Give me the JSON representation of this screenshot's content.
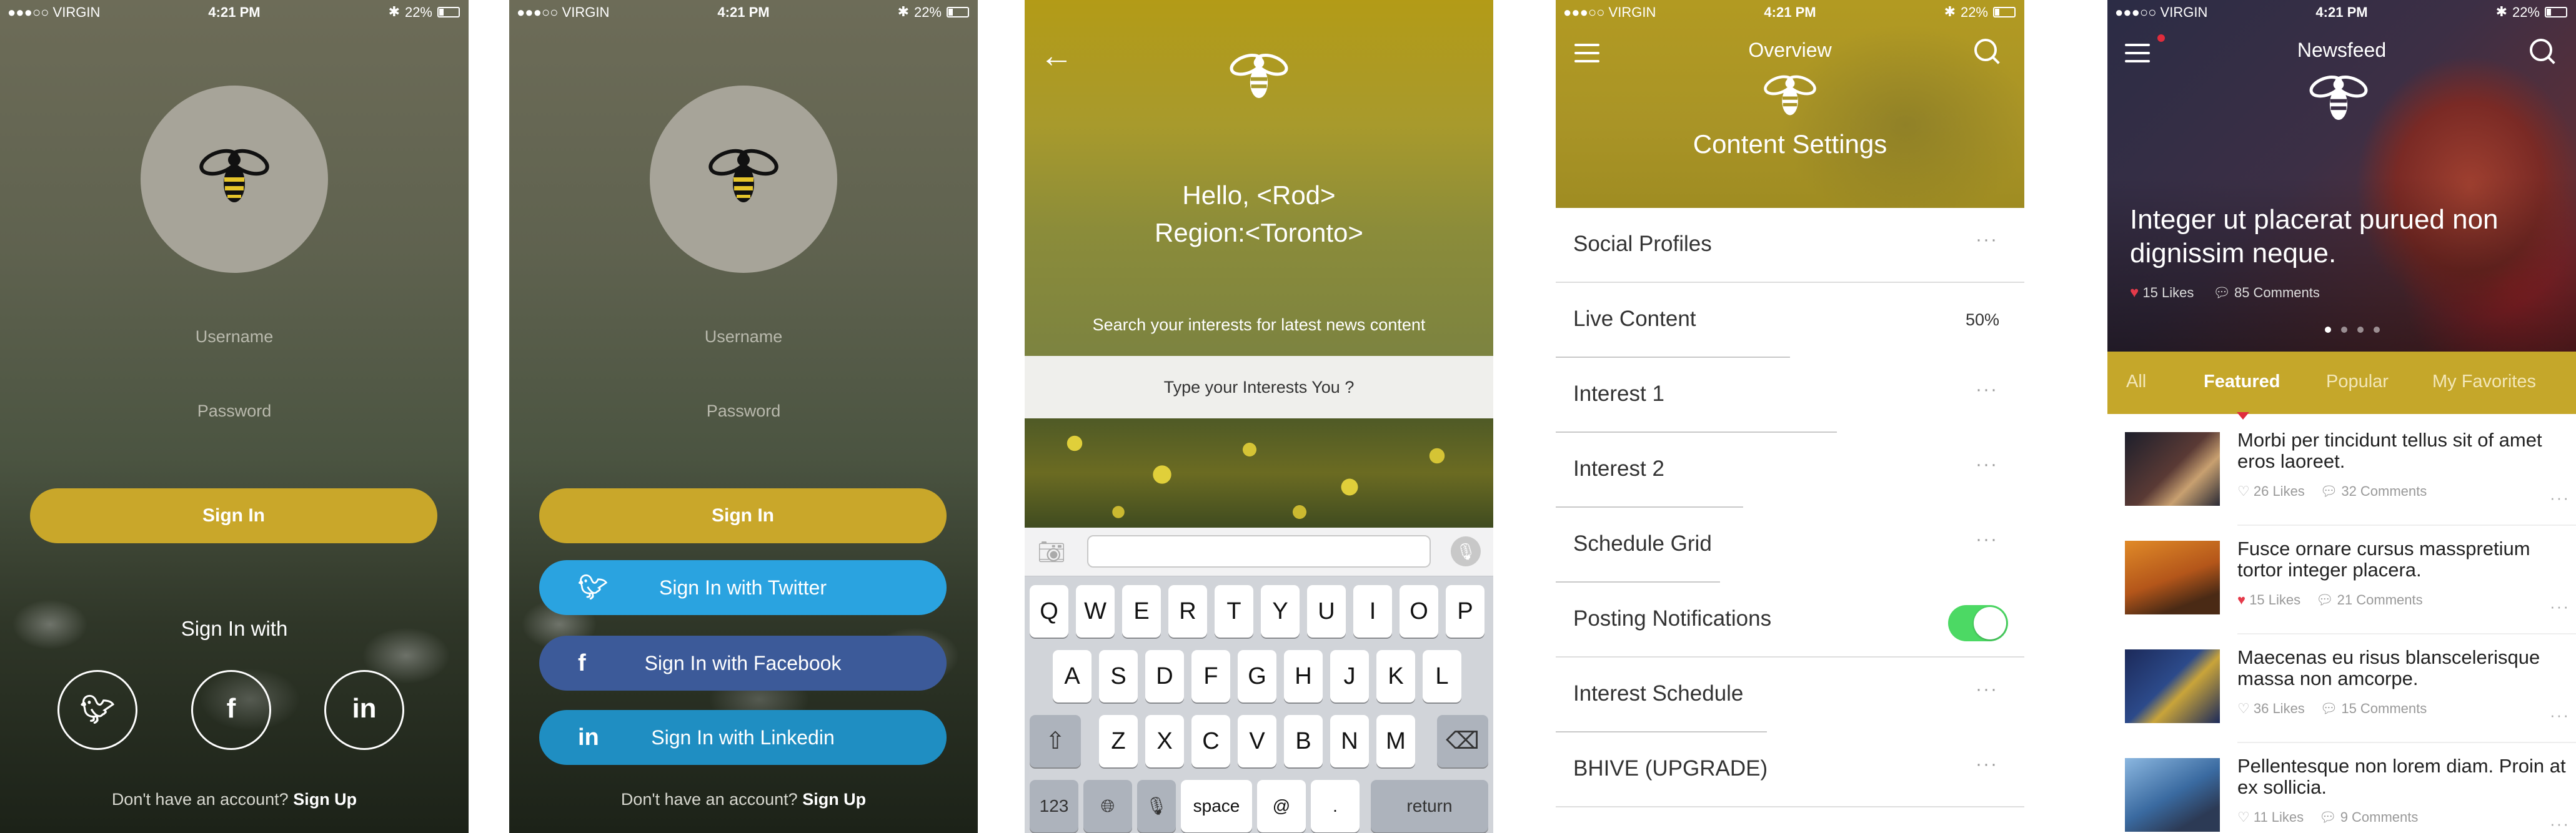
{
  "status_bar": {
    "carrier": "●●●○○ VIRGIN",
    "time": "4:21 PM",
    "battery": "22%"
  },
  "login": {
    "username_placeholder": "Username",
    "password_placeholder": "Password",
    "sign_in": "Sign In",
    "sign_in_with": "Sign In with",
    "no_account": "Don't have an account?",
    "sign_up": "Sign Up"
  },
  "social_buttons": {
    "twitter": "Sign In with Twitter",
    "facebook": "Sign In with Facebook",
    "linkedin": "Sign In with Linkedin"
  },
  "welcome": {
    "hello": "Hello, <Rod>",
    "region": "Region:<Toronto>",
    "search_hint": "Search your interests for latest news content",
    "interest_placeholder": "Type your Interests You ?"
  },
  "keyboard": {
    "row1": [
      "Q",
      "W",
      "E",
      "R",
      "T",
      "Y",
      "U",
      "I",
      "O",
      "P"
    ],
    "row2": [
      "A",
      "S",
      "D",
      "F",
      "G",
      "H",
      "J",
      "K",
      "L"
    ],
    "row3": [
      "Z",
      "X",
      "C",
      "V",
      "B",
      "N",
      "M"
    ],
    "num_key": "123",
    "space": "space",
    "at": "@",
    "dot": ".",
    "return": "return"
  },
  "settings": {
    "header_title": "Overview",
    "page_title": "Content Settings",
    "items": [
      {
        "label": "Social Profiles",
        "value": "···"
      },
      {
        "label": "Live Content",
        "value": "50%"
      },
      {
        "label": "Interest 1",
        "value": "···"
      },
      {
        "label": "Interest 2",
        "value": "···"
      },
      {
        "label": "Schedule Grid",
        "value": "···"
      },
      {
        "label": "Posting Notifications",
        "value": "on"
      },
      {
        "label": "Interest Schedule",
        "value": "···"
      },
      {
        "label": "BHIVE (UPGRADE)",
        "value": "···"
      }
    ]
  },
  "newsfeed": {
    "title": "Newsfeed",
    "hero": {
      "title": "Integer ut placerat purued non dignissim neque.",
      "likes": "15 Likes",
      "comments": "85 Comments"
    },
    "tabs": [
      "All",
      "Featured",
      "Popular",
      "My Favorites"
    ],
    "active_tab": "Featured",
    "items": [
      {
        "title": "Morbi per tincidunt tellus sit of amet eros laoreet.",
        "likes": "26 Likes",
        "comments": "32 Comments",
        "liked": false
      },
      {
        "title": "Fusce ornare cursus masspretium tortor integer placera.",
        "likes": "15 Likes",
        "comments": "21 Comments",
        "liked": true
      },
      {
        "title": "Maecenas eu risus blanscelerisque massa non amcorpe.",
        "likes": "36 Likes",
        "comments": "15 Comments",
        "liked": false
      },
      {
        "title": "Pellentesque non lorem diam. Proin at ex sollicia.",
        "likes": "11 Likes",
        "comments": "9 Comments",
        "liked": false
      }
    ]
  },
  "colors": {
    "accent_gold": "#c9a72a",
    "twitter": "#2aa3e0",
    "facebook": "#3c5a99",
    "linkedin": "#1f8ec2",
    "toggle_on": "#4cd964"
  },
  "icons": [
    "bee-logo-icon",
    "twitter-icon",
    "facebook-icon",
    "linkedin-icon",
    "back-arrow-icon",
    "menu-icon",
    "search-icon",
    "camera-icon",
    "microphone-icon",
    "shift-icon",
    "backspace-icon",
    "globe-icon",
    "heart-icon",
    "comment-icon",
    "more-icon",
    "toggle-switch"
  ]
}
